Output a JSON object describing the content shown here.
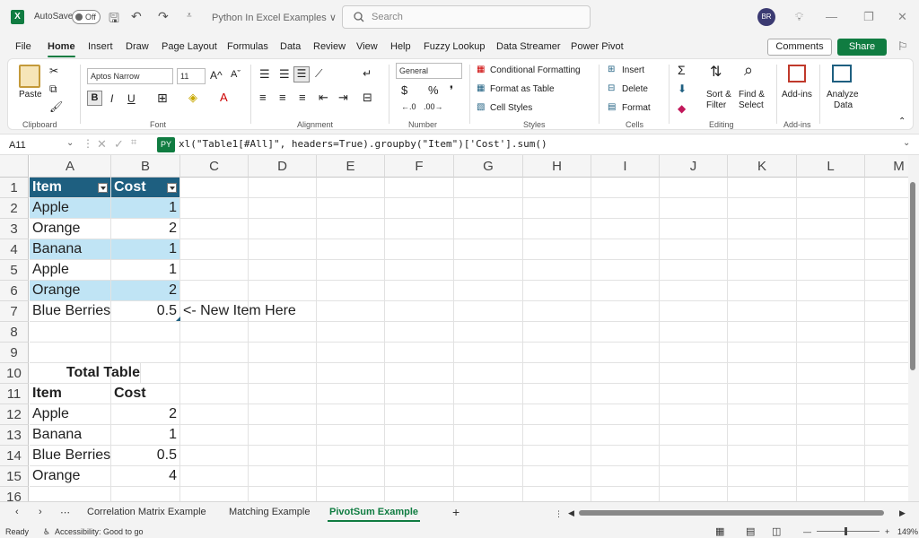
{
  "title_bar": {
    "logo": "X",
    "autosave_label": "AutoSave",
    "autosave_state": "Off",
    "file_name": "Python In Excel Examples ∨",
    "search_placeholder": "Search",
    "user_initials": "BR"
  },
  "menu_tabs": [
    "File",
    "Home",
    "Insert",
    "Draw",
    "Page Layout",
    "Formulas",
    "Data",
    "Review",
    "View",
    "Help",
    "Fuzzy Lookup",
    "Data Streamer",
    "Power Pivot"
  ],
  "active_tab": "Home",
  "comments_label": "Comments",
  "share_label": "Share",
  "ribbon": {
    "clipboard": {
      "paste": "Paste",
      "label": "Clipboard"
    },
    "font": {
      "name": "Aptos Narrow",
      "size": "11",
      "label": "Font"
    },
    "alignment": {
      "label": "Alignment"
    },
    "number": {
      "format": "General",
      "label": "Number",
      "currency": "$",
      "percent": "%"
    },
    "styles": {
      "conditional": "Conditional Formatting",
      "format_table": "Format as Table",
      "cell_styles": "Cell Styles",
      "label": "Styles"
    },
    "cells": {
      "insert": "Insert",
      "delete": "Delete",
      "format": "Format",
      "label": "Cells"
    },
    "editing": {
      "sort_1": "Sort &",
      "sort_2": "Filter",
      "find_1": "Find &",
      "find_2": "Select",
      "label": "Editing"
    },
    "addins": {
      "btn": "Add-ins",
      "label": "Add-ins"
    },
    "analyze": {
      "l1": "Analyze",
      "l2": "Data"
    }
  },
  "formula_bar": {
    "cell_ref": "A11",
    "py_badge": "PY",
    "formula": "xl(\"Table1[#All]\", headers=True).groupby(\"Item\")['Cost'].sum()"
  },
  "grid": {
    "columns": [
      "A",
      "B",
      "C",
      "D",
      "E",
      "F",
      "G",
      "H",
      "I",
      "J",
      "K",
      "L",
      "M"
    ],
    "rows": [
      "1",
      "2",
      "3",
      "4",
      "5",
      "6",
      "7",
      "8",
      "9",
      "10",
      "11",
      "12",
      "13",
      "14",
      "15",
      "16"
    ],
    "table_header": {
      "item": "Item",
      "cost": "Cost"
    },
    "table_rows": [
      {
        "item": "Apple",
        "cost": "1"
      },
      {
        "item": "Orange",
        "cost": "2"
      },
      {
        "item": "Banana",
        "cost": "1"
      },
      {
        "item": "Apple",
        "cost": "1"
      },
      {
        "item": "Orange",
        "cost": "2"
      },
      {
        "item": "Blue Berries",
        "cost": "0.5"
      }
    ],
    "note": "<- New Item Here",
    "total_title": "Total Table",
    "total_header": {
      "item": "Item",
      "cost": "Cost"
    },
    "total_rows": [
      {
        "item": "Apple",
        "cost": "2"
      },
      {
        "item": "Banana",
        "cost": "1"
      },
      {
        "item": "Blue Berries",
        "cost": "0.5"
      },
      {
        "item": "Orange",
        "cost": "4"
      }
    ]
  },
  "sheets": [
    "Correlation Matrix Example",
    "Matching Example",
    "PivotSum Example"
  ],
  "active_sheet": "PivotSum Example",
  "status": {
    "ready": "Ready",
    "accessibility": "Accessibility: Good to go",
    "zoom": "149%"
  },
  "colors": {
    "brand": "#107c41",
    "table_header": "#1e5f80",
    "table_band": "#c0e4f5"
  }
}
